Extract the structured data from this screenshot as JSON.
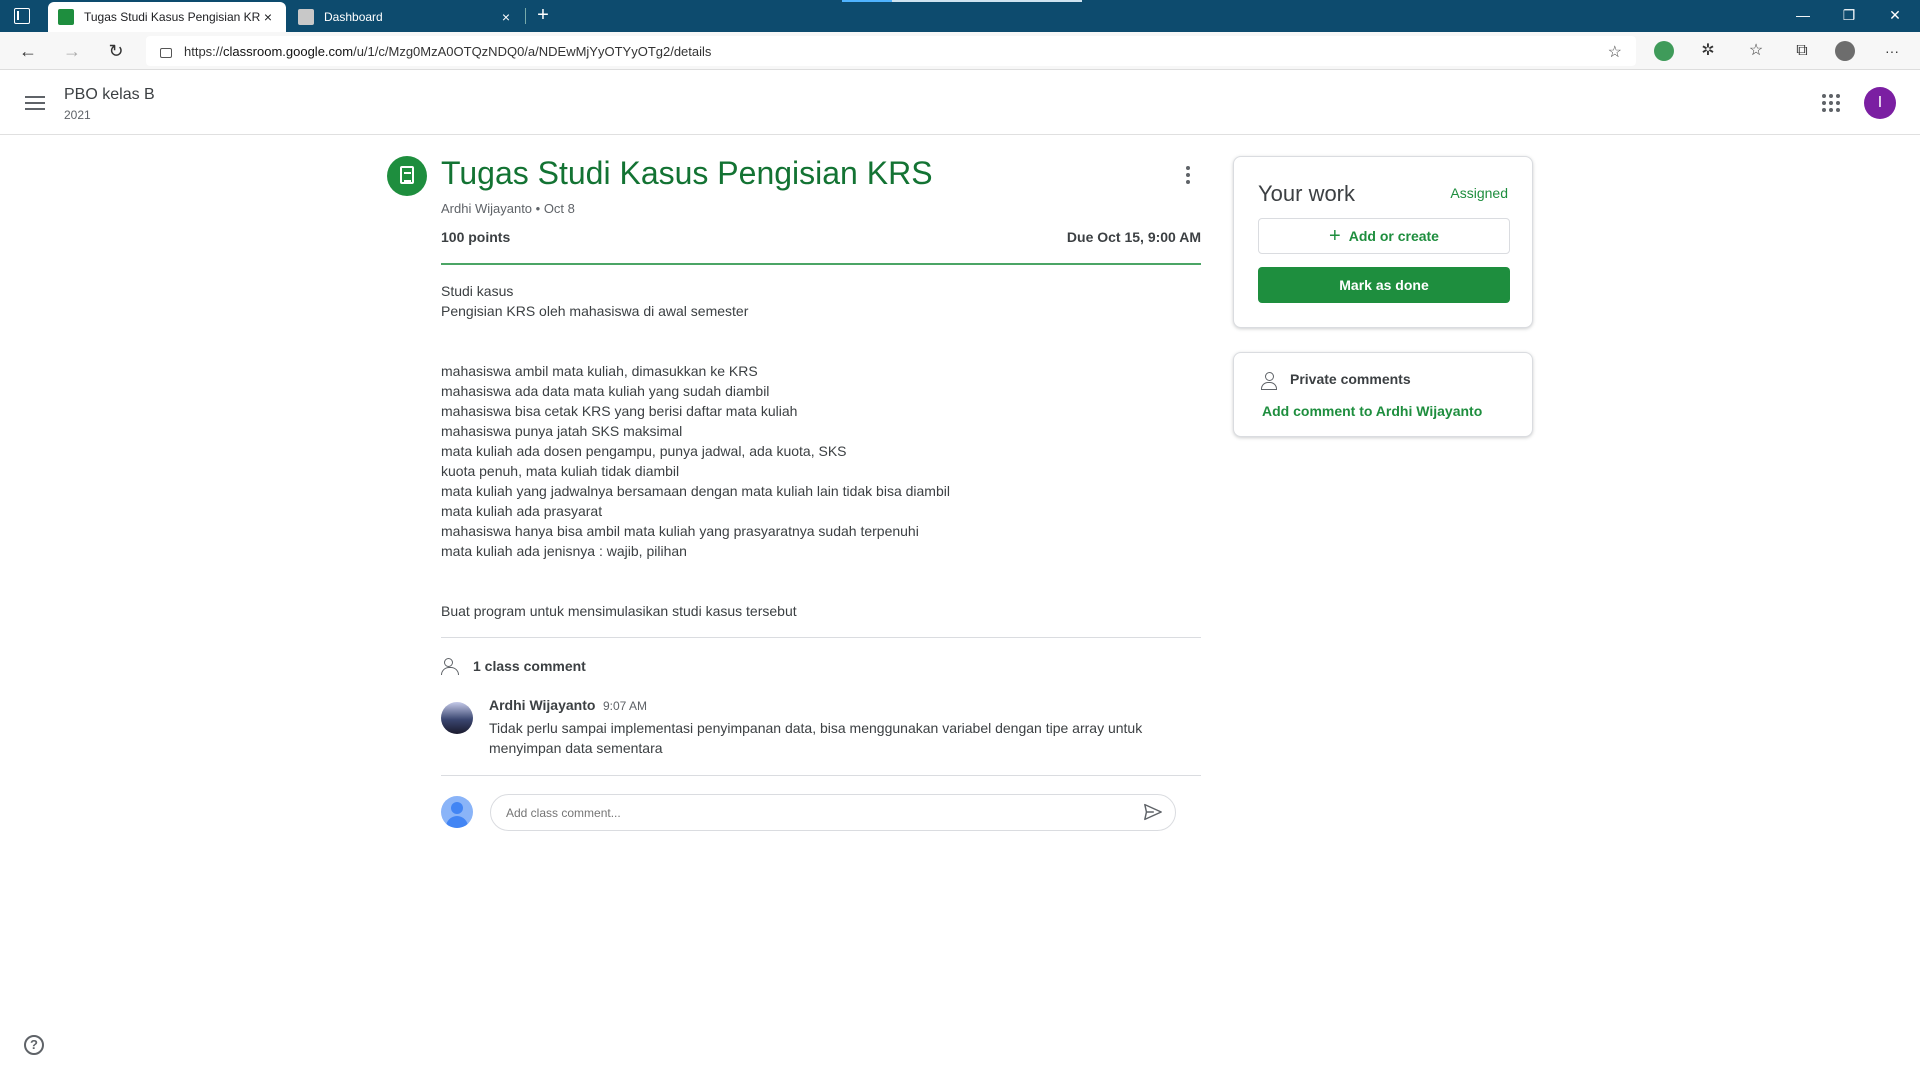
{
  "browser": {
    "tabs": [
      {
        "label": "Tugas Studi Kasus Pengisian KRS",
        "close": "×"
      },
      {
        "label": "Dashboard",
        "close": "×"
      }
    ],
    "new_tab": "+",
    "window_controls": {
      "minimize": "—",
      "maximize": "❐",
      "close": "✕"
    },
    "nav": {
      "back": "←",
      "forward": "→",
      "reload": "↻",
      "more": "···"
    },
    "url_prefix": "https://",
    "url_domain": "classroom.google.com",
    "url_path": "/u/1/c/Mzg0MzA0OTQzNDQ0/a/NDEwMjYyOTYyOTg2/details"
  },
  "header": {
    "class_name": "PBO kelas B",
    "class_section": "2021",
    "user_initial": "I",
    "colors": {
      "avatar": "#7b1fa2"
    }
  },
  "assignment": {
    "title": "Tugas Studi Kasus Pengisian KRS",
    "author_date": "Ardhi Wijayanto • Oct 8",
    "points": "100 points",
    "due": "Due Oct 15, 9:00 AM",
    "description_lines": [
      "Studi kasus",
      "Pengisian KRS oleh mahasiswa di awal semester",
      "",
      "",
      "mahasiswa ambil mata kuliah, dimasukkan ke KRS",
      "mahasiswa ada data mata kuliah yang sudah diambil",
      "mahasiswa bisa cetak KRS yang berisi daftar mata kuliah",
      "mahasiswa punya jatah SKS maksimal",
      "mata kuliah ada dosen pengampu, punya jadwal, ada kuota, SKS",
      "kuota penuh, mata kuliah tidak diambil",
      "mata kuliah yang jadwalnya bersamaan dengan mata kuliah lain tidak bisa diambil",
      "mata kuliah ada prasyarat",
      "mahasiswa hanya bisa ambil mata kuliah yang prasyaratnya sudah terpenuhi",
      "mata kuliah ada jenisnya : wajib, pilihan",
      "",
      "",
      "Buat program untuk mensimulasikan studi kasus tersebut"
    ],
    "colors": {
      "accent": "#1e8e3e",
      "title": "#137333"
    }
  },
  "class_comments": {
    "heading": "1 class comment",
    "items": [
      {
        "author": "Ardhi Wijayanto",
        "time": "9:07 AM",
        "text": "Tidak perlu sampai implementasi penyimpanan data, bisa menggunakan variabel dengan tipe array untuk menyimpan data sementara"
      }
    ],
    "input_placeholder": "Add class comment..."
  },
  "your_work": {
    "title": "Your work",
    "status": "Assigned",
    "add_label": "Add or create",
    "done_label": "Mark as done"
  },
  "private_comments": {
    "title": "Private comments",
    "add_label": "Add comment to Ardhi Wijayanto"
  }
}
